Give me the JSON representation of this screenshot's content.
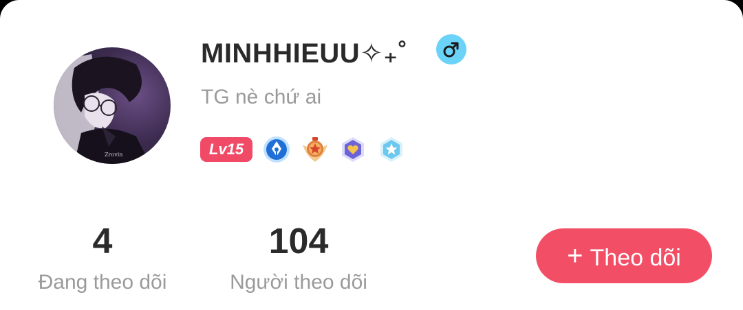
{
  "profile": {
    "username": "MINHHIEUU✧₊˚",
    "gender_icon": "male-icon",
    "bio": "TG nè chứ ai",
    "level_label": "Lv15",
    "avatar_watermark": "Zrovin"
  },
  "medals": [
    {
      "name": "pen-medal-icon",
      "color": "#1f6fd6"
    },
    {
      "name": "star-crest-medal-icon",
      "color": "#e8a04a"
    },
    {
      "name": "heart-hexagon-medal-icon",
      "color": "#6c63d8"
    },
    {
      "name": "star-hexagon-medal-icon",
      "color": "#6cc8ee"
    }
  ],
  "stats": {
    "following_count": "4",
    "following_label": "Đang theo dõi",
    "followers_count": "104",
    "followers_label": "Người theo dõi"
  },
  "actions": {
    "follow_icon": "+",
    "follow_label": "Theo dõi"
  },
  "colors": {
    "accent": "#f24f67",
    "gender_badge": "#6ad3f7",
    "muted_text": "#9a9a9a"
  }
}
